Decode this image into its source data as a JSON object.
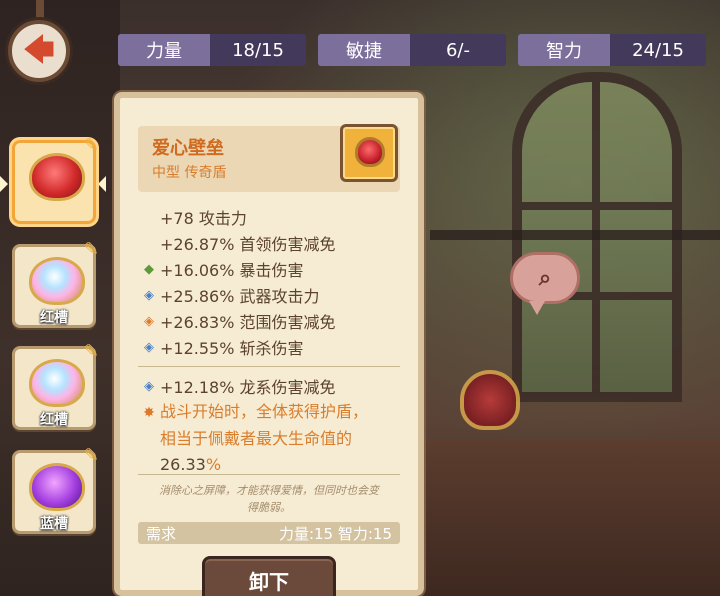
{
  "stats": [
    {
      "label": "力量",
      "value": "18/15"
    },
    {
      "label": "敏捷",
      "value": "6/-"
    },
    {
      "label": "智力",
      "value": "24/15"
    }
  ],
  "slots": [
    {
      "label": "",
      "gem": "red-heart-gem",
      "selected": true
    },
    {
      "label": "红槽",
      "gem": "rainbow-gem",
      "selected": false
    },
    {
      "label": "红槽",
      "gem": "rainbow-gem",
      "selected": false
    },
    {
      "label": "蓝槽",
      "gem": "purple-gem",
      "selected": false
    }
  ],
  "item": {
    "name": "爱心壁垒",
    "type": "中型 传奇盾",
    "icon": "heart-shield-icon",
    "stats": [
      {
        "bullet": "none",
        "text": "+78 攻击力"
      },
      {
        "bullet": "none",
        "text": "+26.87% 首领伤害减免"
      },
      {
        "bullet": "green-diamond",
        "text": "+16.06% 暴击伤害"
      },
      {
        "bullet": "blue-diamond",
        "text": "+25.86% 武器攻击力"
      },
      {
        "bullet": "orange-diamond",
        "text": "+26.83% 范围伤害减免"
      },
      {
        "bullet": "blue-diamond",
        "text": "+12.55% 斩杀伤害"
      }
    ],
    "extra_stat": {
      "bullet": "blue-diamond",
      "text": "+12.18% 龙系伤害减免"
    },
    "effect": {
      "line1": "战斗开始时，全体获得护盾，",
      "line2": "相当于佩戴者最大生命值的",
      "value": "26.33",
      "unit": "%"
    },
    "flavor_line1": "消除心之屏障，才能获得爱情，但同时也会变",
    "flavor_line2": "得脆弱。",
    "requirement_label": "需求",
    "requirement_value": "力量:15 智力:15"
  },
  "unequip_label": "卸下",
  "colors": {
    "stat_label_bg": "#7d6f9c",
    "stat_value_bg": "#43395a",
    "panel_bg": "#f6ecd3",
    "item_name": "#d06a1e",
    "accent_orange": "#d97d2c",
    "green_bullet": "#5d9a3a",
    "blue_bullet": "#4a7fc5",
    "button_bg": "#6b4a3b"
  }
}
